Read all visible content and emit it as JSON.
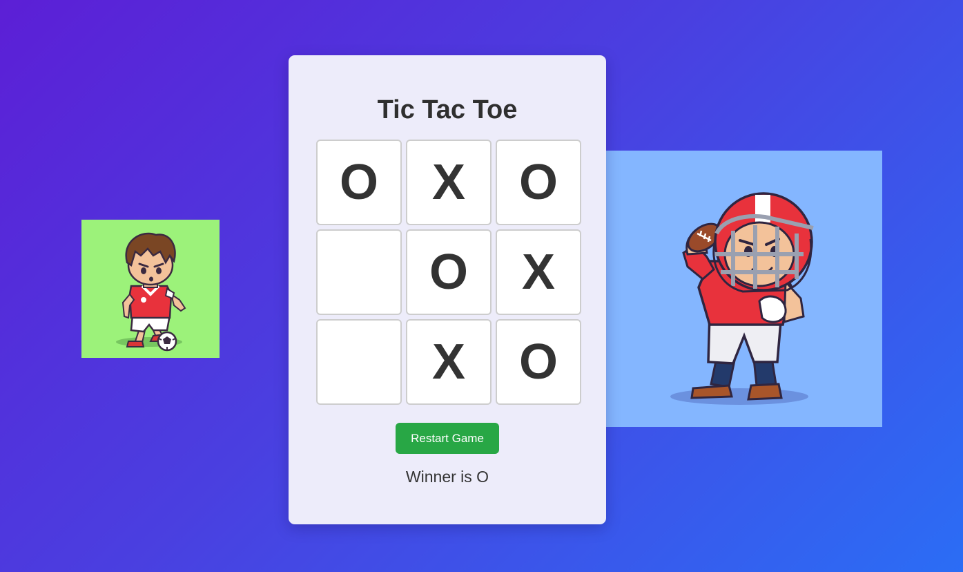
{
  "game": {
    "title": "Tic Tac Toe",
    "board": [
      "O",
      "X",
      "O",
      "",
      "O",
      "X",
      "",
      "X",
      "O"
    ],
    "restart_label": "Restart Game",
    "status": "Winner is O"
  },
  "players": {
    "left": {
      "image": "soccer-player-icon",
      "background": "#9cf27a"
    },
    "right": {
      "image": "football-player-icon",
      "background": "#84b6ff"
    }
  },
  "colors": {
    "card": "#edecfa",
    "accent": "#28a745",
    "text": "#333333"
  }
}
